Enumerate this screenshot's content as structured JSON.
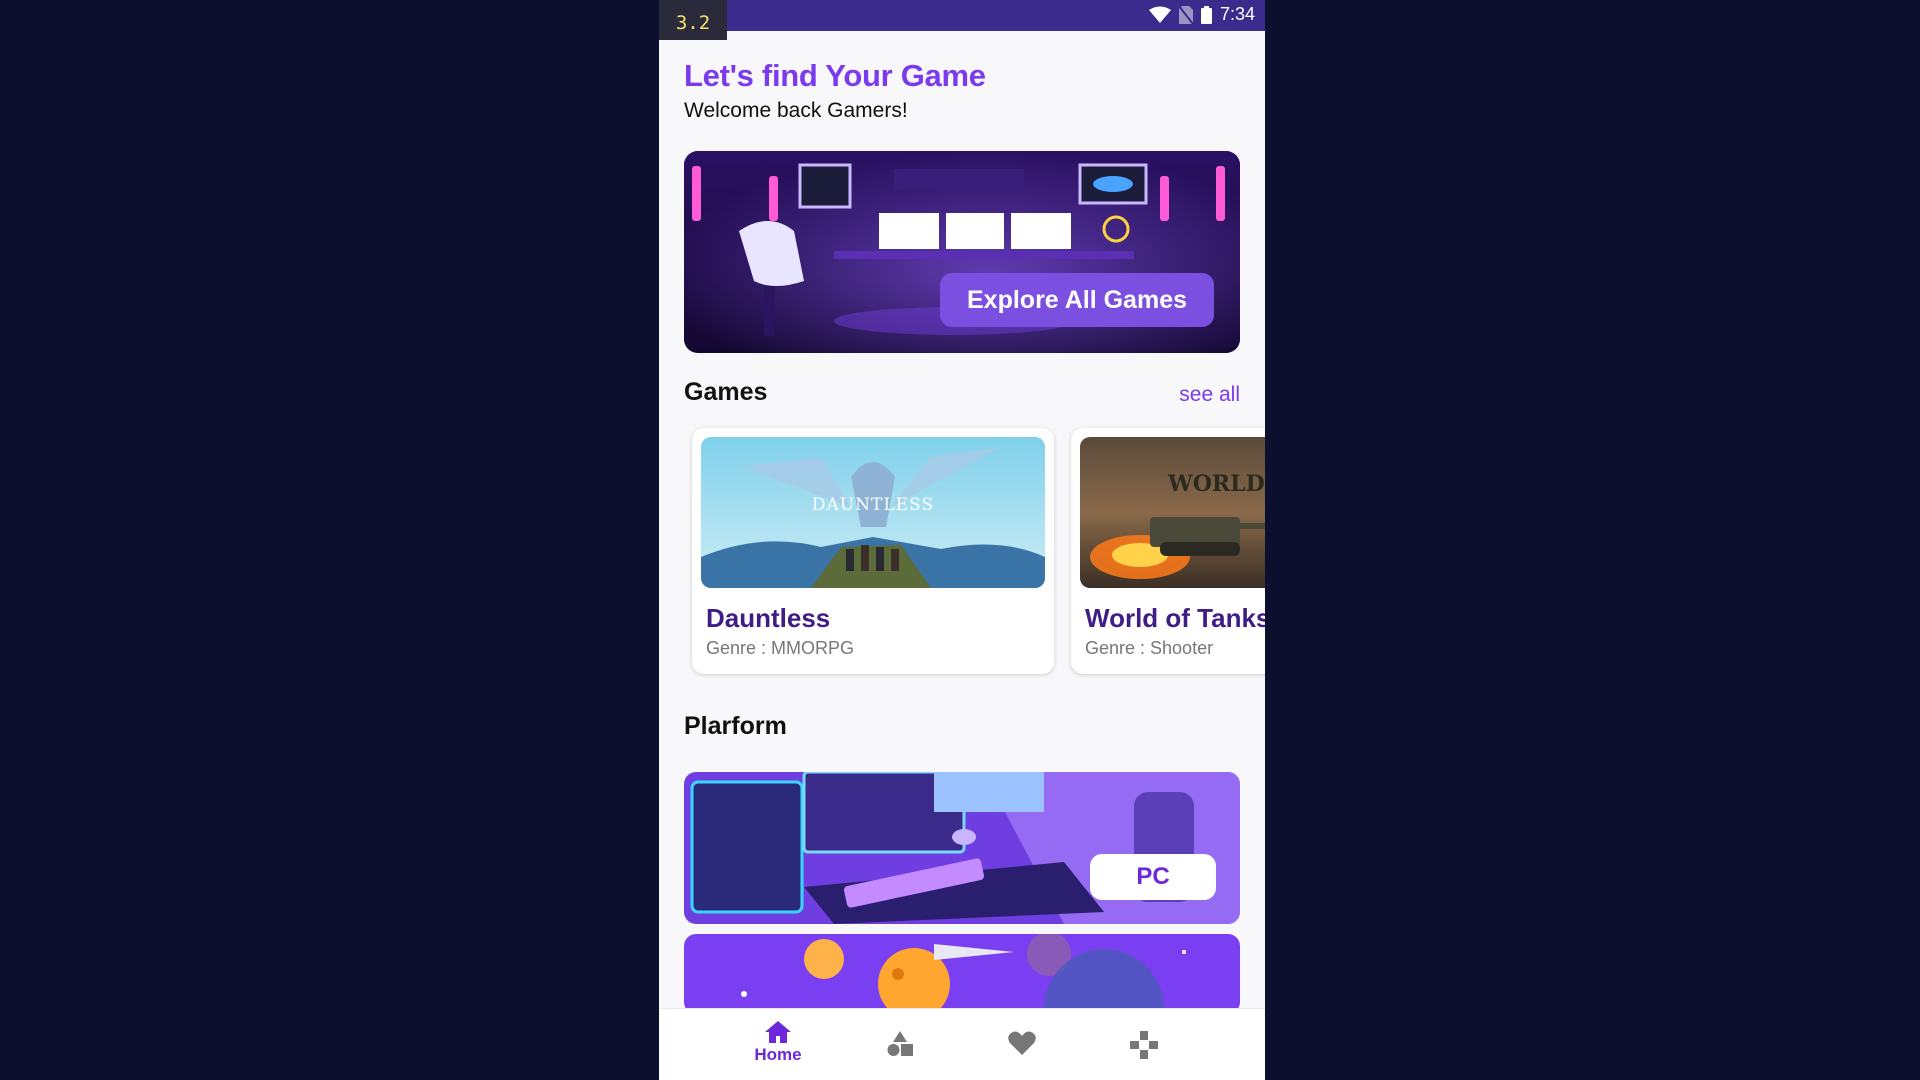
{
  "status_bar": {
    "fps": "3.2",
    "time": "7:34"
  },
  "header": {
    "title": "Let's find Your Game",
    "subtitle": "Welcome back Gamers!"
  },
  "hero": {
    "button_label": "Explore All Games"
  },
  "games_section": {
    "title": "Games",
    "see_all": "see all",
    "cards": [
      {
        "name": "Dauntless",
        "genre": "Genre : MMORPG",
        "logo_text": "DAUNTLESS"
      },
      {
        "name": "World of Tanks",
        "genre": "Genre : Shooter",
        "logo_text": "WORLD OF"
      }
    ]
  },
  "platform_section": {
    "title": "Plarform",
    "items": [
      {
        "label": "PC"
      }
    ]
  },
  "bottom_nav": {
    "items": [
      {
        "icon": "home-icon",
        "label": "Home",
        "active": true
      },
      {
        "icon": "shapes-icon",
        "label": ""
      },
      {
        "icon": "heart-icon",
        "label": ""
      },
      {
        "icon": "gamepad-icon",
        "label": ""
      }
    ]
  },
  "colors": {
    "accent": "#7c3aed",
    "status_bar": "#3b2b8c",
    "page_bg": "#0d0f2e"
  }
}
